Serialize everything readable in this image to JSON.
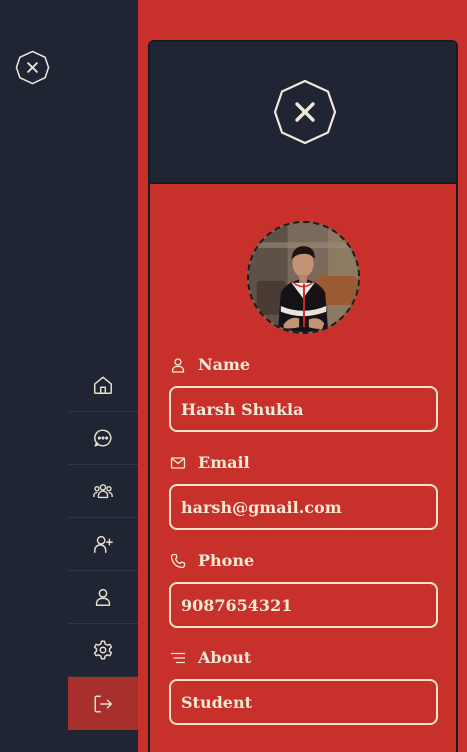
{
  "sidebar": {
    "logo_icon": "close-hexagon-icon",
    "items": [
      {
        "icon": "home-icon",
        "active": false
      },
      {
        "icon": "chat-icon",
        "active": false
      },
      {
        "icon": "group-icon",
        "active": false
      },
      {
        "icon": "add-user-icon",
        "active": false
      },
      {
        "icon": "user-icon",
        "active": false
      },
      {
        "icon": "settings-icon",
        "active": false
      },
      {
        "icon": "logout-icon",
        "active": true
      }
    ]
  },
  "profile": {
    "header_icon": "close-hexagon-icon",
    "avatar_alt": "profile photo",
    "fields": {
      "name": {
        "label": "Name",
        "value": "Harsh Shukla",
        "icon": "user-icon"
      },
      "email": {
        "label": "Email",
        "value": "harsh@gmail.com",
        "icon": "mail-icon"
      },
      "phone": {
        "label": "Phone",
        "value": "9087654321",
        "icon": "phone-icon"
      },
      "about": {
        "label": "About",
        "value": "Student",
        "icon": "text-lines-icon"
      }
    }
  },
  "colors": {
    "background": "#c8312b",
    "sidebar": "#1f2532",
    "accent_text": "#f6ead5",
    "active_item": "#a8302c"
  }
}
